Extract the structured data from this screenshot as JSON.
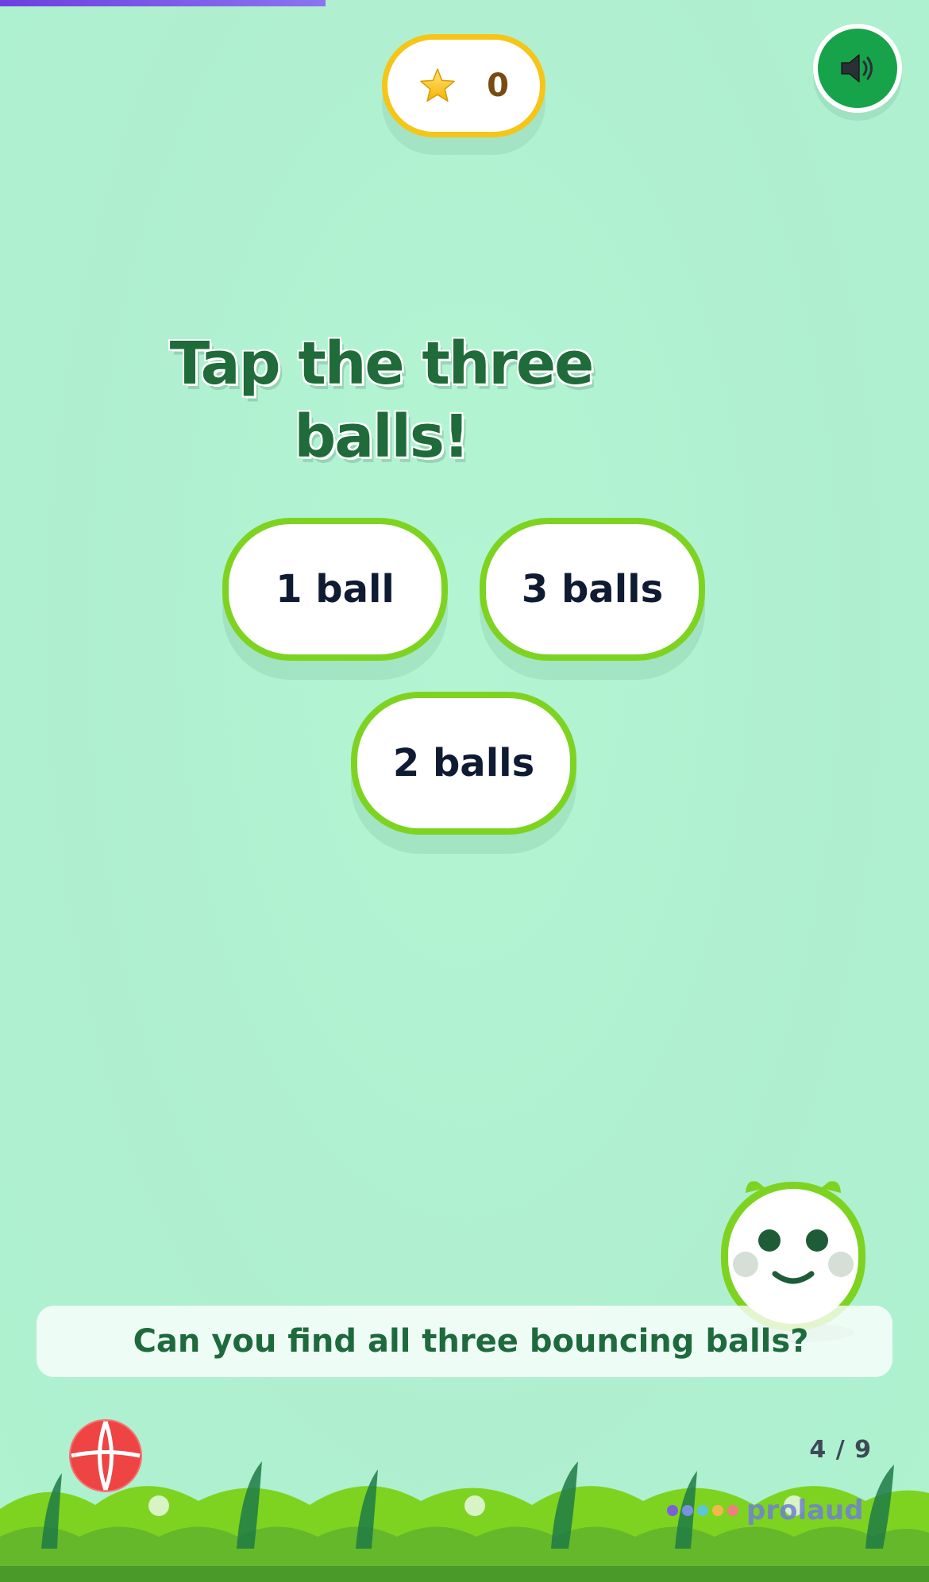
{
  "progress": {
    "fraction": 0.35,
    "colors": [
      "#6d3fe0",
      "#8a74f0"
    ]
  },
  "score": {
    "icon": "star-icon",
    "value": "0"
  },
  "sound": {
    "icon": "speaker-icon",
    "color": "#16a34a"
  },
  "question": {
    "title": "Tap the three balls!"
  },
  "answers": [
    {
      "label": "1 ball"
    },
    {
      "label": "3 balls"
    },
    {
      "label": "2 balls"
    }
  ],
  "hint": {
    "text": "Can you find all three bouncing balls?"
  },
  "pagination": {
    "text": "4 / 9"
  },
  "brand": {
    "name": "prolaud",
    "dot_colors": [
      "#7b5fd6",
      "#7a8fe6",
      "#5cc6d6",
      "#f2b84b",
      "#f07e7e"
    ]
  },
  "colors": {
    "accent": "#7ed321",
    "title": "#1f6b3a",
    "score_border": "#f5c518",
    "help": "#ef4444"
  }
}
